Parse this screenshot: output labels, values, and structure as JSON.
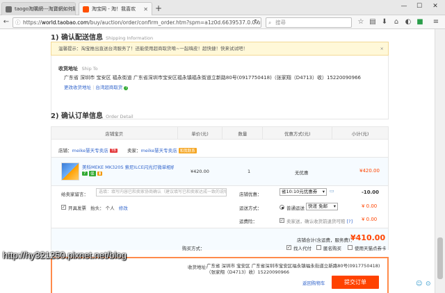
{
  "browser": {
    "tabs": [
      {
        "title": "taogo淘購網---淘寶網如何購",
        "favicon_color": "#6a6a6a",
        "active": false
      },
      {
        "title": "淘宝网 - 淘！我喜欢",
        "favicon_color": "#ff5000",
        "active": true
      }
    ],
    "new_tab": "+",
    "window_controls": [
      "—",
      "☐",
      "✕"
    ],
    "url_prefix": "https://",
    "url_host": "world.taobao.com",
    "url_path": "/buy/auction/order/confirm_order.htm?spm=a1z0d.6639537.0.0.und",
    "search_placeholder": "搜尋"
  },
  "shipping": {
    "title": "1) 确认配送信息",
    "subtitle": "Shipping Information",
    "notice": "温馨提示：淘宝推出直送台湾服务了！还能使用超商取货唷~一起嗨皮！超快捷！快来试试吧！",
    "notice_close": "×",
    "addr_label": "收货地址",
    "addr_label_en": "Ship To",
    "address": "广东省 深圳市 宝安区 福永街道 广东省深圳市宝安区福永镇福永街道立新路80号(0917750418)（张家翔（D4713）收）15220090966",
    "change_link": "更改收货地址",
    "taiwan_link": "台湾超商取货"
  },
  "order": {
    "title": "2) 确认订单信息",
    "subtitle": "Order Detail",
    "headers": [
      "店铺宝贝",
      "单价(元)",
      "数量",
      "优惠方式(元)",
      "小计(元)"
    ],
    "shop_label": "店铺：",
    "shop_name": "meike慧天专卖店",
    "seller_label": "卖家：",
    "seller_name": "meike慧天专卖店",
    "seller_badge": "和我联系",
    "item": {
      "name": "美科MEKE MK320S 索尼ILCE闪光灯微单相机 TTL…",
      "price": "¥420.00",
      "qty": "1",
      "discount": "无优惠",
      "subtotal": "¥420.00"
    },
    "message_label": "给卖家留言：",
    "message_placeholder": "选填：填写内容已和卖家协商确认（建议填写已和卖家达成一致的说明）",
    "store_discount_label": "店铺优惠：",
    "store_discount_value": "省10:10元优惠券",
    "store_discount_amount": "-10.00",
    "invoice_label": "开具发票",
    "invoice_head_label": "抬头：",
    "invoice_head": "个人",
    "invoice_edit": "修改",
    "shipping_label": "运送方式：",
    "shipping_option": "普通运送",
    "shipping_select": "快递 免邮",
    "shipping_fee": "¥ 0.00",
    "insurance_label": "运费险：",
    "insurance_text": "卖家送，确认收货前退货可赔",
    "insurance_help": "[?]",
    "insurance_fee": "¥ 0.00",
    "total_label": "店铺合计(含运费，服务费)：",
    "total": "¥410.00",
    "buy_method_label": "购买方式：",
    "options": [
      "找人代付",
      "匿名购买",
      "使用天猫点券卡"
    ]
  },
  "confirm": {
    "addr_label": "收货地址:",
    "address": "广东省 深圳市 宝安区 广东省深圳市宝安区福永镇福永街道立新路80号(0917750418)（张家翔（D4713）收）15220090966",
    "back_link": "返回购物车",
    "submit": "提交订单"
  },
  "watermark": "http://hy321250.pixnet.net/blog",
  "colors": {
    "accent": "#ff4200",
    "price": "#f40",
    "link": "#3366cc"
  }
}
